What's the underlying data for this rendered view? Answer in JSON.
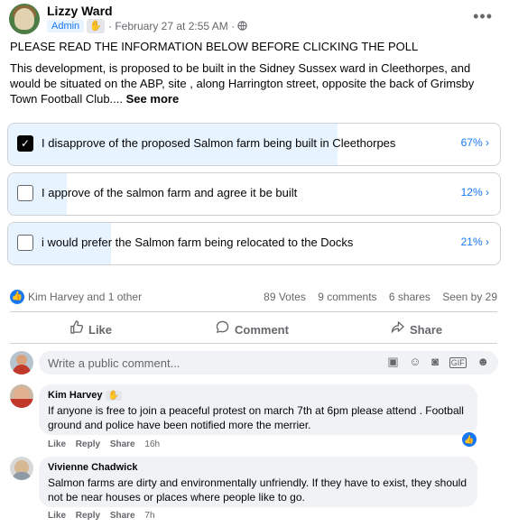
{
  "post": {
    "author": "Lizzy Ward",
    "role_badge": "Admin",
    "extra_badge": "✋",
    "timestamp": "· February 27 at 2:55 AM · ",
    "audience_icon": "globe-icon",
    "menu": "•••",
    "headline": "PLEASE READ THE INFORMATION BELOW BEFORE CLICKING THE POLL",
    "body": "This development, is proposed to be built in the Sidney Sussex ward in Cleethorpes, and would be situated on the ABP, site , along Harrington street, opposite  the back of Grimsby Town Football Club....",
    "see_more": "See more"
  },
  "poll": {
    "options": [
      {
        "label": "I disapprove of the proposed Salmon farm being built in Cleethorpes",
        "percent": "67%",
        "fill": 0.67,
        "checked": true
      },
      {
        "label": "I approve of the salmon farm and agree it be built",
        "percent": "12%",
        "fill": 0.12,
        "checked": false
      },
      {
        "label": "i would prefer the Salmon farm being relocated to the Docks",
        "percent": "21%",
        "fill": 0.21,
        "checked": false
      }
    ]
  },
  "reactions": {
    "who": "Kim Harvey and 1 other",
    "votes": "89 Votes",
    "comments": "9 comments",
    "shares": "6 shares",
    "seen": "Seen by 29"
  },
  "actions": {
    "like": "Like",
    "comment": "Comment",
    "share": "Share"
  },
  "composer": {
    "placeholder": "Write a public comment...",
    "tools": [
      "sticker-icon",
      "emoji-icon",
      "camera-icon",
      "gif-icon",
      "avatar-sticker-icon"
    ]
  },
  "comments": [
    {
      "author": "Kim Harvey",
      "badge": "✋",
      "text": "If anyone is free to join a peaceful protest on march 7th at 6pm please attend . Football ground and police have been notified more the merrier.",
      "like": "Like",
      "reply": "Reply",
      "share": "Share",
      "time": "16h"
    },
    {
      "author": "Vivienne Chadwick",
      "text": "Salmon farms are dirty and environmentally unfriendly. If they have to exist, they should not be near houses or places where people like to go.",
      "like": "Like",
      "reply": "Reply",
      "share": "Share",
      "time": "7h"
    }
  ],
  "colors": {
    "accent": "#1877f2",
    "poll_fill": "#e7f3ff",
    "muted": "#65676b"
  }
}
